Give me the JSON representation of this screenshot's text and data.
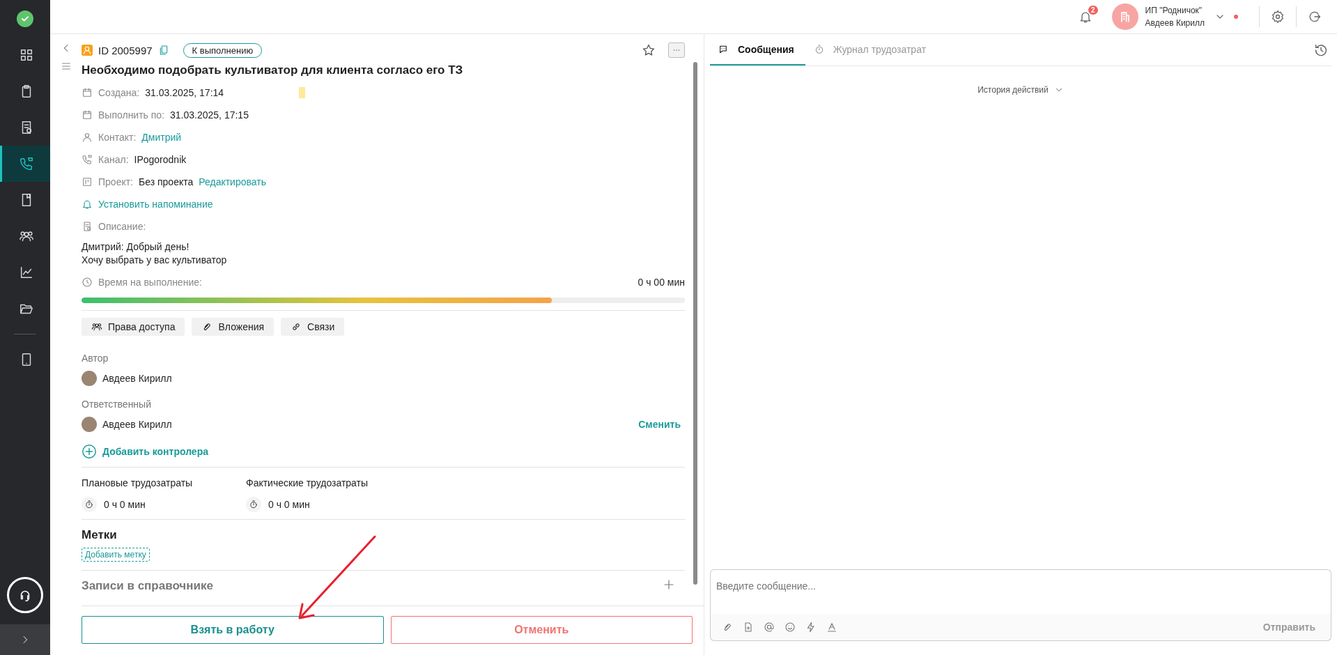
{
  "sidebar": {
    "items": [
      {
        "selected": false
      },
      {
        "selected": false
      },
      {
        "selected": false
      },
      {
        "selected": true
      },
      {
        "selected": false
      },
      {
        "selected": false
      },
      {
        "selected": false
      },
      {
        "selected": false
      },
      {
        "selected": false
      }
    ]
  },
  "header": {
    "notifications": "2",
    "org": "ИП \"Родничок\"",
    "user": "Авдеев Кирилл"
  },
  "task": {
    "id": "ID 2005997",
    "status": "К выполнению",
    "title": "Необходимо подобрать культиватор для клиента согласо его ТЗ",
    "fields": [
      {
        "kind": "created",
        "label": "Создана:",
        "value": "31.03.2025, 17:14"
      },
      {
        "kind": "due",
        "label": "Выполнить по:",
        "value": "31.03.2025, 17:15"
      },
      {
        "kind": "contact",
        "label": "Контакт:",
        "value": "Дмитрий"
      },
      {
        "kind": "channel",
        "label": "Канал:",
        "value": "IPogorodnik"
      },
      {
        "kind": "project",
        "label": "Проект:",
        "value": "Без проекта",
        "link": "Редактировать"
      }
    ],
    "reminder": "Установить напоминание",
    "description_label": "Описание:",
    "description": [
      "Дмитрий: Добрый день!",
      "Хочу выбрать у вас культиватор"
    ],
    "time_label": "Время на выполнение:",
    "time_value": "0 ч 00 мин",
    "progress": {
      "level": 0.78
    },
    "actions": [
      {
        "kind": "access",
        "label": "Права доступа"
      },
      {
        "kind": "attachments",
        "label": "Вложения"
      },
      {
        "kind": "links",
        "label": "Связи"
      }
    ],
    "author": {
      "label": "Автор",
      "name": "Авдеев Кирилл"
    },
    "responsible": {
      "label": "Ответственный",
      "name": "Авдеев Кирилл",
      "action": "Сменить"
    },
    "add_controller": "Добавить контролера",
    "effort": [
      {
        "label": "Плановые трудозатраты",
        "value": "0 ч 0 мин"
      },
      {
        "label": "Фактические трудозатраты",
        "value": "0 ч 0 мин"
      }
    ],
    "tags": {
      "title": "Метки",
      "add": "Добавить метку"
    },
    "directory": {
      "title": "Записи в справочнике"
    },
    "buttons": [
      {
        "kind": "primary",
        "label": "Взять в работу"
      },
      {
        "kind": "danger",
        "label": "Отменить"
      }
    ]
  },
  "messages": {
    "tabs": [
      {
        "label": "Сообщения",
        "selected": true
      },
      {
        "label": "Журнал трудозатрат",
        "selected": false
      }
    ],
    "history": "История действий",
    "placeholder": "Введите сообщение...",
    "send": "Отправить"
  }
}
